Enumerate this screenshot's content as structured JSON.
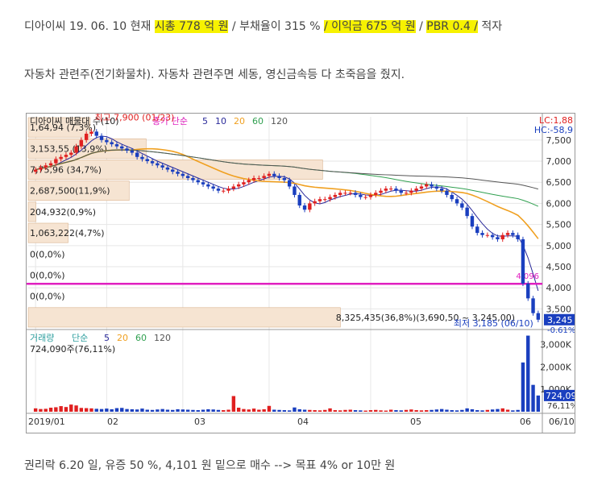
{
  "text": {
    "line1": {
      "p1": "디아이씨 19. 06. 10 현재 ",
      "h1": "시총  778 억 원",
      "p2": " / 부채율이 315 % ",
      "h2": "/ 이익금 675 억 원",
      "p3": " / ",
      "h3": "PBR 0.4 /",
      "p4": " 적자"
    },
    "line2": "자동차 관련주(전기화물차). 자동차 관련주면 세동, 영신금속등 다 초죽음을 줬지.",
    "line3": "권리락 6.20 일, 유증 50 %, 4,101 원 밑으로 매수 --> 목표 4% or 10만 원"
  },
  "colors": {
    "highlight": "#f7f200",
    "up": "#e02020",
    "down": "#1a3fbf",
    "ma5": "#2a2a9a",
    "ma20": "#f0a020",
    "ma60": "#30a050",
    "ma120": "#555555",
    "magenta": "#e020c0",
    "volume_box": "#f6e4d2"
  },
  "chart_data": {
    "type": "candlestick",
    "price_legend": {
      "name": "디아이씨 매물대 수(10)",
      "ma_title": "종가 단순",
      "ma_periods": [
        "5",
        "10",
        "20",
        "60",
        "120"
      ]
    },
    "volume_legend": {
      "name": "거래량",
      "ma_title": "단순",
      "ma_periods": [
        "5",
        "20",
        "60",
        "120"
      ]
    },
    "lc_label": "LC:1,88",
    "hc_label": "HC:-58,9",
    "x_ticks": [
      "2019/01",
      "02",
      "03",
      "04",
      "05",
      "06",
      "06/10"
    ],
    "y_ticks": [
      "7,500",
      "7,000",
      "6,500",
      "6,000",
      "5,500",
      "5,000",
      "4,500",
      "4,000",
      "3,500"
    ],
    "y_range": [
      3050,
      8050
    ],
    "volume_ticks": [
      "3,000K",
      "2,000K",
      "1,000K"
    ],
    "volume_range": [
      0,
      3600
    ],
    "max_label": "최고 7,900 (01/23)",
    "min_label": "최저 3,185 (06/10)",
    "last_price": "3,245",
    "last_price_label_below": "-0.61%",
    "last_volume": "724,09",
    "last_volume_label_below": "76,11%",
    "level_line": 4096,
    "level_label": "4,096",
    "volume_note": "724,090주(76,11%)",
    "volume_profile": [
      {
        "label": "8,325,435(36,8%)(3,690,50 ~ 3,245,00)",
        "pct": 0.368
      },
      {
        "label": "0(0,0%)",
        "pct": 0
      },
      {
        "label": "0(0,0%)",
        "pct": 0
      },
      {
        "label": "0(0,0%)",
        "pct": 0
      },
      {
        "label": "1,063,222(4,7%)",
        "pct": 0.047
      },
      {
        "label": "204,932(0,9%)",
        "pct": 0.009
      },
      {
        "label": "2,687,500(11,9%)",
        "pct": 0.119
      },
      {
        "label": "7,75,96 (34,7%)",
        "pct": 0.347
      },
      {
        "label": "3,153,55 (13,9%)",
        "pct": 0.139
      },
      {
        "label": "1,64,94 (7,3%)",
        "pct": 0.073
      }
    ],
    "close": [
      6800,
      6850,
      6900,
      6950,
      7050,
      7100,
      7150,
      7200,
      7350,
      7500,
      7650,
      7700,
      7600,
      7500,
      7450,
      7400,
      7350,
      7300,
      7250,
      7200,
      7100,
      7050,
      7000,
      6950,
      6900,
      6850,
      6800,
      6750,
      6700,
      6650,
      6600,
      6550,
      6500,
      6450,
      6400,
      6350,
      6300,
      6300,
      6350,
      6400,
      6450,
      6500,
      6550,
      6600,
      6600,
      6650,
      6700,
      6650,
      6600,
      6550,
      6400,
      6200,
      5950,
      5850,
      6000,
      6050,
      6100,
      6100,
      6150,
      6200,
      6250,
      6250,
      6250,
      6200,
      6150,
      6150,
      6200,
      6250,
      6300,
      6350,
      6350,
      6300,
      6250,
      6250,
      6300,
      6350,
      6400,
      6450,
      6400,
      6350,
      6300,
      6200,
      6100,
      6000,
      5900,
      5700,
      5450,
      5300,
      5250,
      5250,
      5200,
      5150,
      5250,
      5300,
      5250,
      5150,
      4100,
      3750,
      3400,
      3245
    ],
    "volume": [
      150,
      120,
      130,
      180,
      200,
      250,
      210,
      320,
      280,
      170,
      160,
      150,
      130,
      120,
      140,
      110,
      160,
      170,
      120,
      110,
      100,
      140,
      90,
      80,
      100,
      120,
      90,
      80,
      110,
      100,
      90,
      80,
      70,
      90,
      110,
      100,
      80,
      70,
      90,
      700,
      180,
      120,
      100,
      140,
      90,
      110,
      260,
      90,
      80,
      70,
      60,
      190,
      110,
      90,
      80,
      70,
      60,
      80,
      150,
      70,
      60,
      80,
      90,
      70,
      60,
      50,
      70,
      80,
      60,
      50,
      90,
      70,
      60,
      80,
      100,
      70,
      60,
      70,
      80,
      100,
      120,
      90,
      70,
      60,
      80,
      150,
      110,
      70,
      60,
      80,
      100,
      120,
      150,
      90,
      60,
      80,
      2200,
      3400,
      1200,
      724
    ]
  }
}
